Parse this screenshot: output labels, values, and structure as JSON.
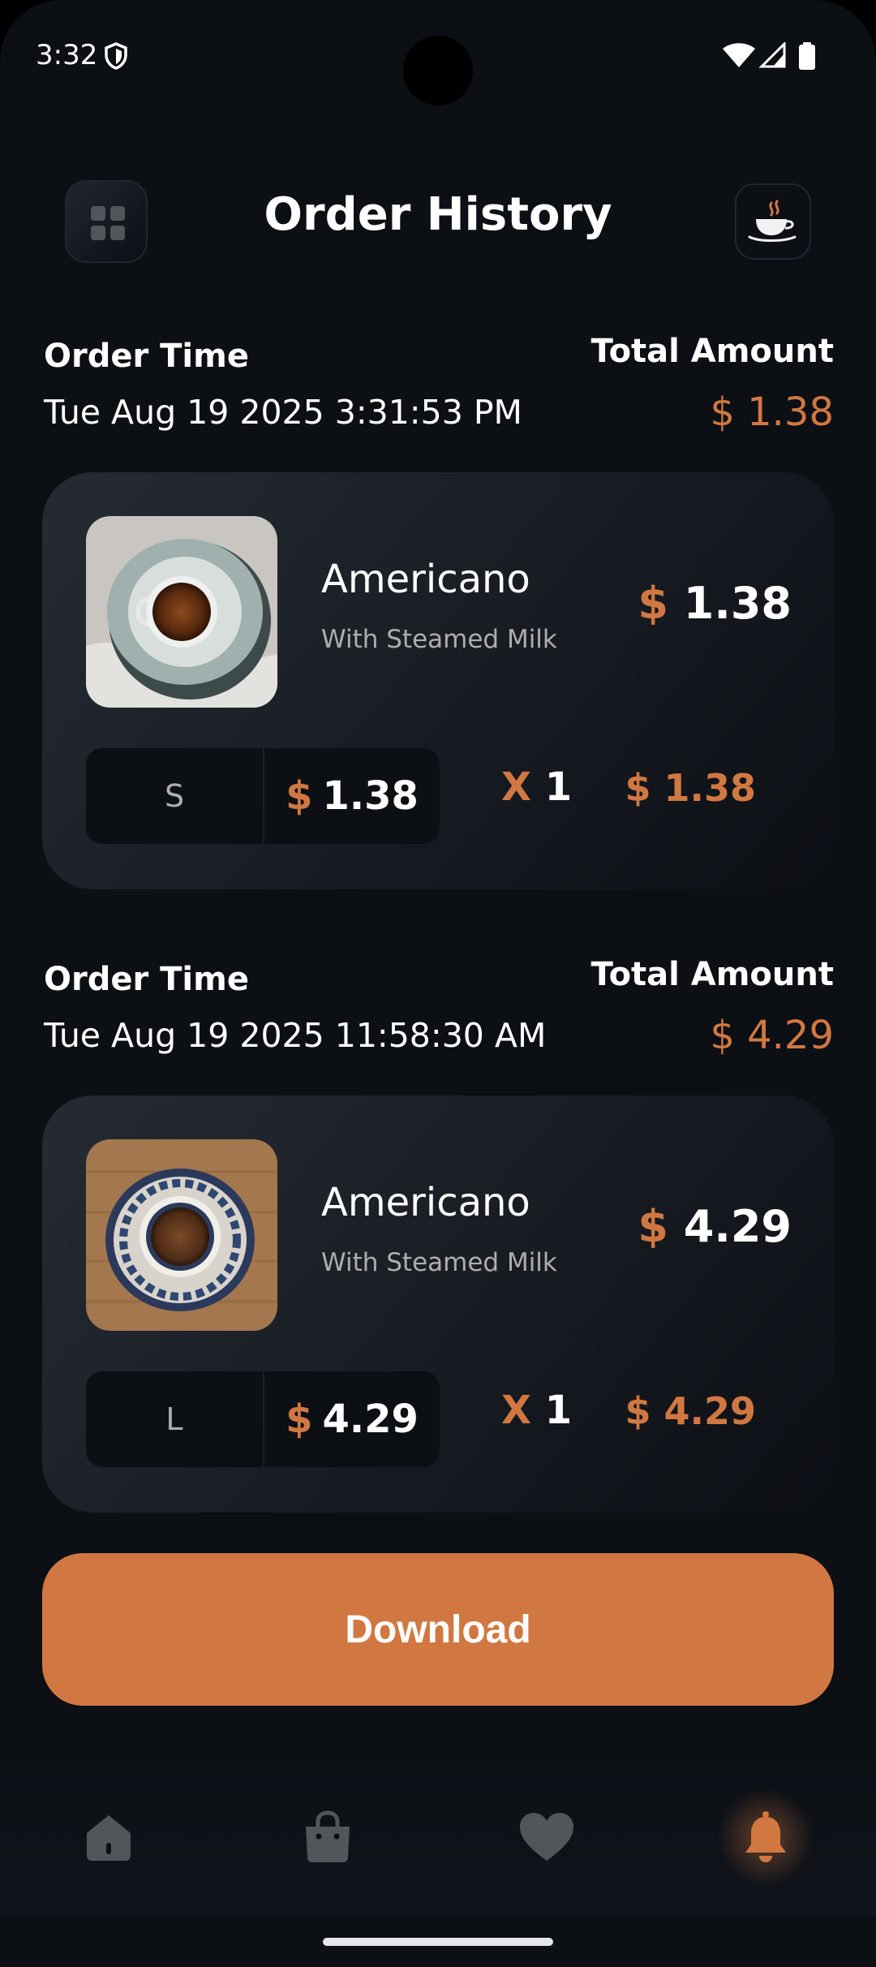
{
  "status_bar": {
    "time": "3:32"
  },
  "header": {
    "title": "Order History"
  },
  "orders": [
    {
      "order_time_label": "Order Time",
      "order_time": "Tue Aug 19 2025 3:31:53 PM",
      "total_amount_label": "Total Amount",
      "total_amount": "$ 1.38",
      "item": {
        "name": "Americano",
        "subtitle": "With Steamed Milk",
        "price_currency": "$",
        "price_value": "1.38",
        "size": "S",
        "size_price_currency": "$",
        "size_price_value": "1.38",
        "qty_prefix": "X",
        "qty": "1",
        "line_total": "$ 1.38"
      }
    },
    {
      "order_time_label": "Order Time",
      "order_time": "Tue Aug 19 2025 11:58:30 AM",
      "total_amount_label": "Total Amount",
      "total_amount": "$ 4.29",
      "item": {
        "name": "Americano",
        "subtitle": "With Steamed Milk",
        "price_currency": "$",
        "price_value": "4.29",
        "size": "L",
        "size_price_currency": "$",
        "size_price_value": "4.29",
        "qty_prefix": "X",
        "qty": "1",
        "line_total": "$ 4.29"
      }
    }
  ],
  "download_button": {
    "label": "Download"
  },
  "bottom_nav": {
    "items": [
      {
        "icon": "home-icon",
        "active": false
      },
      {
        "icon": "shopping-bag-icon",
        "active": false
      },
      {
        "icon": "heart-icon",
        "active": false
      },
      {
        "icon": "bell-icon",
        "active": true
      }
    ]
  },
  "colors": {
    "accent": "#d17842",
    "background": "#0c0f14",
    "card": "#262b33",
    "inactive_icon": "#52555a",
    "secondary_text": "#aeaeae"
  }
}
